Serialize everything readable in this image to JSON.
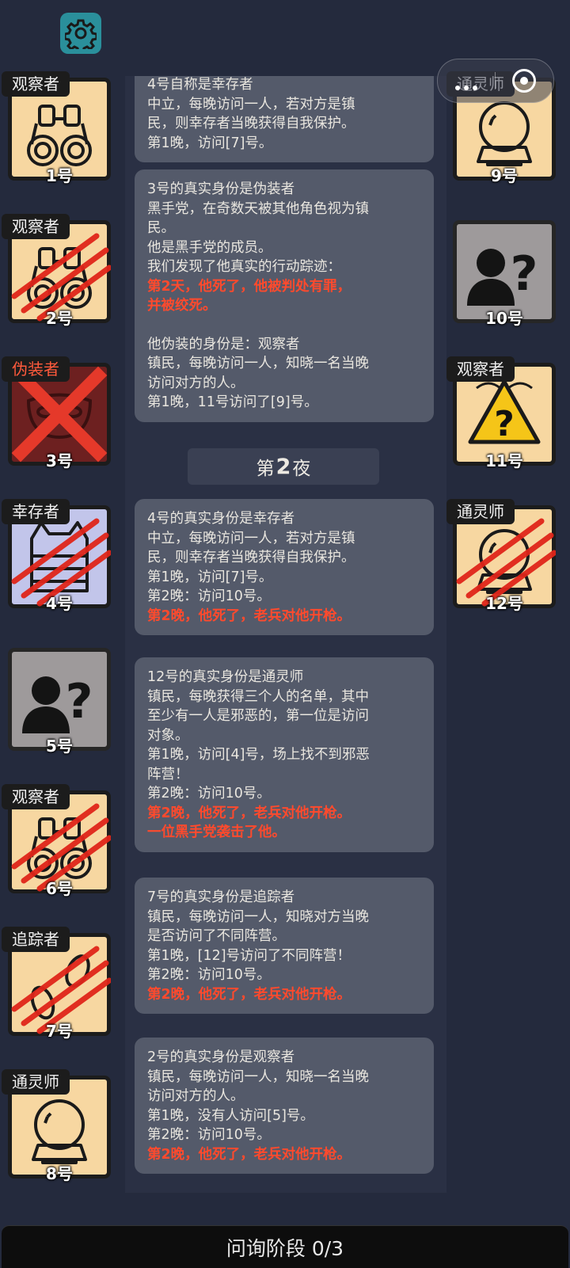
{
  "top_bar": {
    "settings_icon": "gear-icon"
  },
  "left_players": [
    {
      "role": "观察者",
      "number": "1号",
      "icon": "binoculars-icon",
      "status": "alive"
    },
    {
      "role": "观察者",
      "number": "2号",
      "icon": "binoculars-icon",
      "status": "dead"
    },
    {
      "role": "伪装者",
      "number": "3号",
      "icon": "mask-icon",
      "status": "executed"
    },
    {
      "role": "幸存者",
      "number": "4号",
      "icon": "vest-icon",
      "status": "dead"
    },
    {
      "role": "",
      "number": "5号",
      "icon": "unknown-person-icon",
      "status": "unknown"
    },
    {
      "role": "观察者",
      "number": "6号",
      "icon": "binoculars-icon",
      "status": "dead"
    },
    {
      "role": "追踪者",
      "number": "7号",
      "icon": "footprints-icon",
      "status": "dead"
    },
    {
      "role": "通灵师",
      "number": "8号",
      "icon": "crystal-ball-icon",
      "status": "alive"
    }
  ],
  "right_players": [
    {
      "role": "通灵师",
      "number": "9号",
      "icon": "crystal-ball-icon",
      "status": "alive"
    },
    {
      "role": "",
      "number": "10号",
      "icon": "unknown-person-icon",
      "status": "unknown"
    },
    {
      "role": "观察者",
      "number": "11号",
      "icon": "warning-question-icon",
      "status": "alive"
    },
    {
      "role": "通灵师",
      "number": "12号",
      "icon": "crystal-ball-icon",
      "status": "dead"
    }
  ],
  "messages": [
    {
      "lines": [
        {
          "text": "4号自称是幸存者",
          "style": "normal"
        },
        {
          "text": "中立，每晚访问一人，若对方是镇",
          "style": "normal"
        },
        {
          "text": "民，则幸存者当晚获得自我保护。",
          "style": "normal"
        },
        {
          "text": "第1晚，访问[7]号。",
          "style": "normal"
        }
      ]
    },
    {
      "lines": [
        {
          "text": "3号的真实身份是伪装者",
          "style": "normal"
        },
        {
          "text": "黑手党，在奇数天被其他角色视为镇",
          "style": "normal"
        },
        {
          "text": "民。",
          "style": "normal"
        },
        {
          "text": "他是黑手党的成员。",
          "style": "normal"
        },
        {
          "text": "我们发现了他真实的行动踪迹：",
          "style": "normal"
        },
        {
          "text": "第2天，他死了，他被判处有罪，",
          "style": "red"
        },
        {
          "text": "并被绞死。",
          "style": "red"
        },
        {
          "text": "",
          "style": "gap"
        },
        {
          "text": "他伪装的身份是：观察者",
          "style": "normal"
        },
        {
          "text": "镇民，每晚访问一人，知晓一名当晚",
          "style": "normal"
        },
        {
          "text": "访问对方的人。",
          "style": "normal"
        },
        {
          "text": "第1晚，11号访问了[9]号。",
          "style": "normal"
        }
      ]
    },
    {
      "lines": [
        {
          "text": "4号的真实身份是幸存者",
          "style": "normal"
        },
        {
          "text": "中立，每晚访问一人，若对方是镇",
          "style": "normal"
        },
        {
          "text": "民，则幸存者当晚获得自我保护。",
          "style": "normal"
        },
        {
          "text": "第1晚，访问[7]号。",
          "style": "normal"
        },
        {
          "text": "第2晚：访问10号。",
          "style": "normal"
        },
        {
          "text": "第2晚，他死了，老兵对他开枪。",
          "style": "red"
        }
      ]
    },
    {
      "lines": [
        {
          "text": "12号的真实身份是通灵师",
          "style": "normal"
        },
        {
          "text": "镇民，每晚获得三个人的名单，其中",
          "style": "normal"
        },
        {
          "text": "至少有一人是邪恶的，第一位是访问",
          "style": "normal"
        },
        {
          "text": "对象。",
          "style": "normal"
        },
        {
          "text": "第1晚，访问[4]号，场上找不到邪恶",
          "style": "normal"
        },
        {
          "text": "阵营！",
          "style": "normal"
        },
        {
          "text": "第2晚：访问10号。",
          "style": "normal"
        },
        {
          "text": "第2晚，他死了，老兵对他开枪。",
          "style": "red"
        },
        {
          "text": "一位黑手党袭击了他。",
          "style": "red"
        }
      ]
    },
    {
      "lines": [
        {
          "text": "7号的真实身份是追踪者",
          "style": "normal"
        },
        {
          "text": "镇民，每晚访问一人，知晓对方当晚",
          "style": "normal"
        },
        {
          "text": "是否访问了不同阵营。",
          "style": "normal"
        },
        {
          "text": "第1晚，[12]号访问了不同阵营！",
          "style": "normal"
        },
        {
          "text": "第2晚：访问10号。",
          "style": "normal"
        },
        {
          "text": "第2晚，他死了，老兵对他开枪。",
          "style": "red"
        }
      ]
    },
    {
      "lines": [
        {
          "text": "2号的真实身份是观察者",
          "style": "normal"
        },
        {
          "text": "镇民，每晚访问一人，知晓一名当晚",
          "style": "normal"
        },
        {
          "text": "访问对方的人。",
          "style": "normal"
        },
        {
          "text": "第1晚，没有人访问[5]号。",
          "style": "normal"
        },
        {
          "text": "第2晚：访问10号。",
          "style": "normal"
        },
        {
          "text": "第2晚，他死了，老兵对他开枪。",
          "style": "red"
        }
      ]
    }
  ],
  "night_divider": {
    "prefix": "第",
    "number": "2",
    "suffix": "夜"
  },
  "bottom_bar": {
    "phase_label": "问询阶段 0/3"
  },
  "colors": {
    "background": "#242a3d",
    "card_bg": "#f7d7a1",
    "message_bg": "#545a6a",
    "alert_red": "#ff4a2d",
    "gear_teal": "#2a8f9b"
  }
}
